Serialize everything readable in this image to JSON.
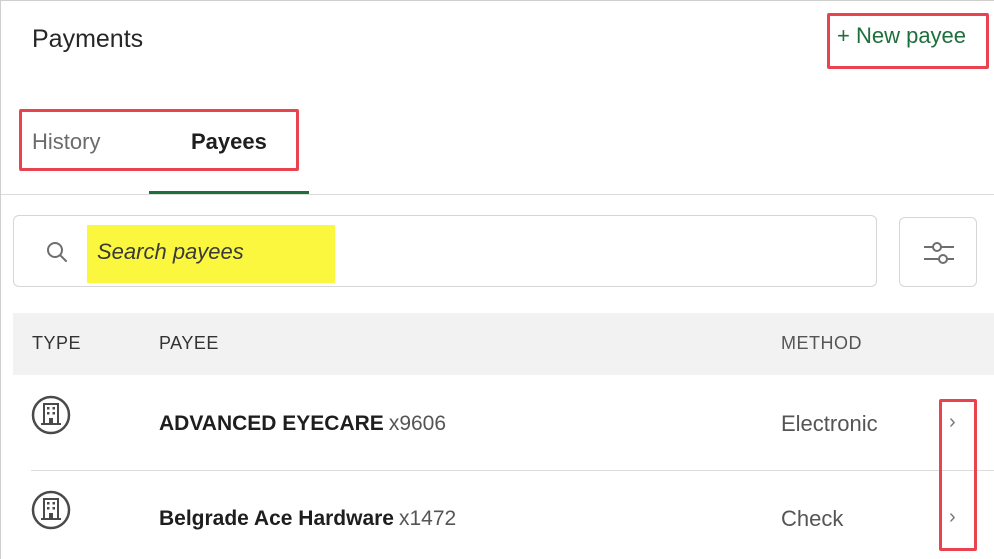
{
  "header": {
    "title": "Payments",
    "new_payee_label": "+ New payee"
  },
  "tabs": [
    {
      "label": "History",
      "active": false
    },
    {
      "label": "Payees",
      "active": true
    }
  ],
  "search": {
    "placeholder": "Search payees",
    "value": ""
  },
  "table": {
    "columns": [
      "TYPE",
      "PAYEE",
      "METHOD"
    ],
    "rows": [
      {
        "type_icon": "building-icon",
        "name": "ADVANCED EYECARE",
        "account": "x9606",
        "method": "Electronic"
      },
      {
        "type_icon": "building-icon",
        "name": "Belgrade Ace Hardware",
        "account": "x1472",
        "method": "Check"
      }
    ]
  },
  "colors": {
    "accent": "#1f6f3d",
    "highlight_box": "#e8434e",
    "search_highlight": "#fbf73f"
  },
  "icons": {
    "search": "search-icon",
    "filter": "sliders-icon",
    "row_type": "building-icon",
    "row_chevron": "chevron-right-icon"
  }
}
